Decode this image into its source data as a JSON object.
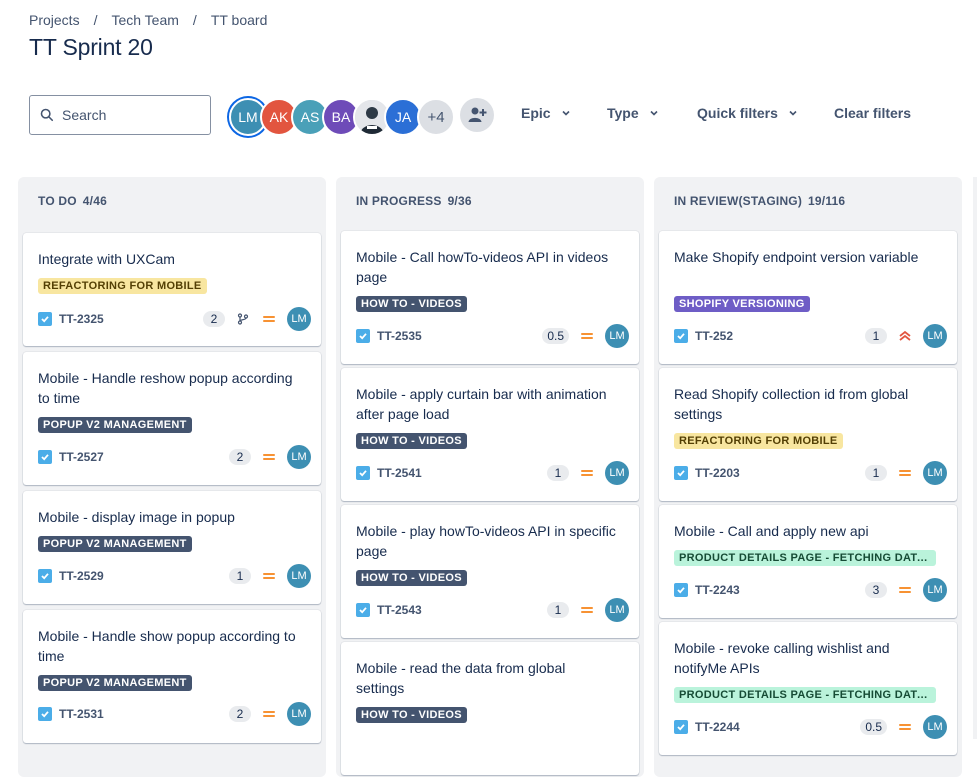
{
  "breadcrumb": [
    "Projects",
    "Tech Team",
    "TT board"
  ],
  "breadcrumb_separator": "/",
  "page_title": "TT Sprint 20",
  "search": {
    "placeholder": "Search"
  },
  "avatars": [
    {
      "initials": "LM",
      "color": "#3d8fb3",
      "selected": true
    },
    {
      "initials": "AK",
      "color": "#e2553f"
    },
    {
      "initials": "AS",
      "color": "#4aa0b8"
    },
    {
      "initials": "BA",
      "color": "#6e4bb8"
    },
    {
      "initials": "",
      "color": "#cfd3d8",
      "photo": true
    },
    {
      "initials": "JA",
      "color": "#2b6fd6"
    }
  ],
  "avatar_more": "+4",
  "filters": {
    "epic": "Epic",
    "type": "Type",
    "quick": "Quick filters",
    "clear": "Clear filters"
  },
  "colors": {
    "story_icon": "#4bade8",
    "priority_medium": "#f79233",
    "priority_high": "#e2553f"
  },
  "columns": [
    {
      "name": "TO DO",
      "count": "4/46",
      "cards": [
        {
          "title": "Integrate with UXCam",
          "label": "REFACTORING FOR MOBILE",
          "label_style": "yellow",
          "key": "TT-2325",
          "points": "2",
          "branch": true,
          "priority": "medium",
          "assignee": "LM"
        },
        {
          "title": "Mobile - Handle reshow popup according to time",
          "label": "POPUP V2 MANAGEMENT",
          "label_style": "gray",
          "key": "TT-2527",
          "points": "2",
          "priority": "medium",
          "assignee": "LM"
        },
        {
          "title": "Mobile - display image in popup",
          "label": "POPUP V2 MANAGEMENT",
          "label_style": "gray",
          "key": "TT-2529",
          "points": "1",
          "priority": "medium",
          "assignee": "LM"
        },
        {
          "title": "Mobile - Handle show popup according to time",
          "label": "POPUP V2 MANAGEMENT",
          "label_style": "gray",
          "key": "TT-2531",
          "points": "2",
          "priority": "medium",
          "assignee": "LM"
        }
      ]
    },
    {
      "name": "IN PROGRESS",
      "count": "9/36",
      "cards": [
        {
          "title": "Mobile - Call howTo-videos API in videos page",
          "label": "HOW TO - VIDEOS",
          "label_style": "gray",
          "key": "TT-2535",
          "points": "0.5",
          "priority": "medium",
          "assignee": "LM"
        },
        {
          "title": "Mobile - apply curtain bar with animation after page load",
          "label": "HOW TO - VIDEOS",
          "label_style": "gray",
          "key": "TT-2541",
          "points": "1",
          "priority": "medium",
          "assignee": "LM"
        },
        {
          "title": "Mobile - play howTo-videos API in specific page",
          "label": "HOW TO - VIDEOS",
          "label_style": "gray",
          "key": "TT-2543",
          "points": "1",
          "priority": "medium",
          "assignee": "LM"
        },
        {
          "title": "Mobile - read the data from global settings",
          "label": "HOW TO - VIDEOS",
          "label_style": "gray"
        }
      ]
    },
    {
      "name": "IN REVIEW(STAGING)",
      "count": "19/116",
      "cards": [
        {
          "title": "Make Shopify endpoint version variable",
          "label": "SHOPIFY VERSIONING",
          "label_style": "purple",
          "key": "TT-252",
          "points": "1",
          "priority": "high",
          "assignee": "LM"
        },
        {
          "title": "Read Shopify collection id from global settings",
          "label": "REFACTORING FOR MOBILE",
          "label_style": "yellow",
          "key": "TT-2203",
          "points": "1",
          "priority": "medium",
          "assignee": "LM"
        },
        {
          "title": "Mobile - Call and apply new api",
          "label": "PRODUCT DETAILS PAGE - FETCHING DATA ...",
          "label_style": "green",
          "key": "TT-2243",
          "points": "3",
          "priority": "medium",
          "assignee": "LM"
        },
        {
          "title": "Mobile - revoke calling wishlist and notifyMe APIs",
          "label": "PRODUCT DETAILS PAGE - FETCHING DATA ...",
          "label_style": "green",
          "key": "TT-2244",
          "points": "0.5",
          "priority": "medium",
          "assignee": "LM"
        }
      ]
    }
  ]
}
